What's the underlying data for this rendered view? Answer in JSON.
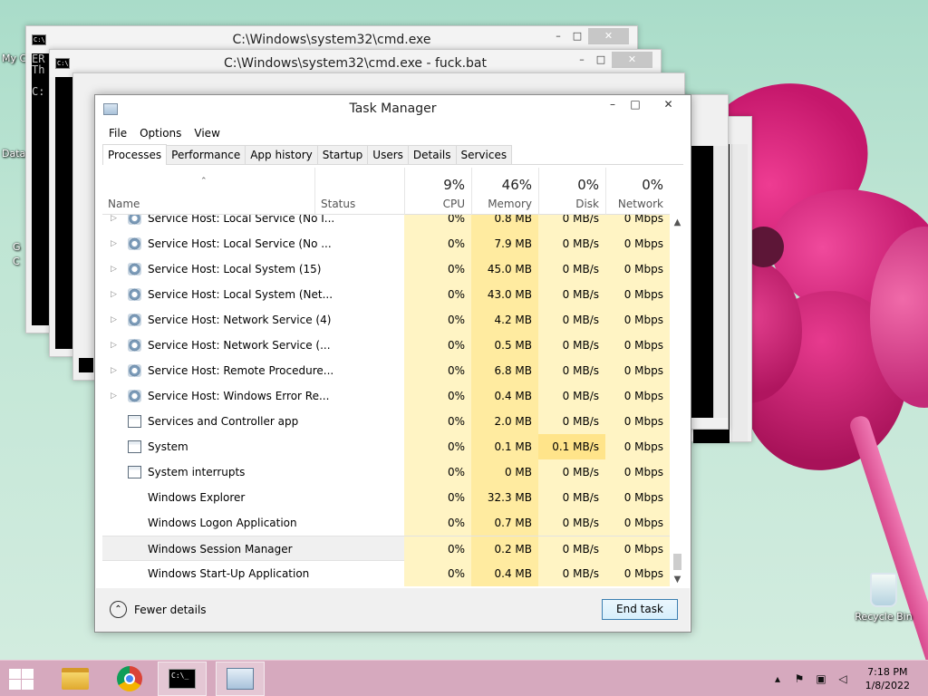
{
  "desktop": {
    "recycle_bin_label": "Recycle Bin",
    "left_icons_partial": [
      "My C",
      "Data",
      "G",
      "C"
    ]
  },
  "cmd_windows": [
    {
      "title": "C:\\Windows\\system32\\cmd.exe",
      "text_lines": [
        "ER",
        "Th",
        "",
        "C:"
      ]
    },
    {
      "title": "C:\\Windows\\system32\\cmd.exe - fuck.bat"
    }
  ],
  "task_manager": {
    "title": "Task Manager",
    "menu": [
      "File",
      "Options",
      "View"
    ],
    "tabs": [
      "Processes",
      "Performance",
      "App history",
      "Startup",
      "Users",
      "Details",
      "Services"
    ],
    "active_tab": "Processes",
    "columns": {
      "name": "Name",
      "status": "Status",
      "cpu": {
        "pct": "9%",
        "label": "CPU"
      },
      "memory": {
        "pct": "46%",
        "label": "Memory"
      },
      "disk": {
        "pct": "0%",
        "label": "Disk"
      },
      "network": {
        "pct": "0%",
        "label": "Network"
      }
    },
    "rows": [
      {
        "name": "Service Host: Local Service (No I...",
        "cpu": "0%",
        "memory": "0.8 MB",
        "disk": "0 MB/s",
        "network": "0 Mbps",
        "icon": "gear-icon",
        "expandable": true
      },
      {
        "name": "Service Host: Local Service (No ...",
        "cpu": "0%",
        "memory": "7.9 MB",
        "disk": "0 MB/s",
        "network": "0 Mbps",
        "icon": "gear-icon",
        "expandable": true
      },
      {
        "name": "Service Host: Local System (15)",
        "cpu": "0%",
        "memory": "45.0 MB",
        "disk": "0 MB/s",
        "network": "0 Mbps",
        "icon": "gear-icon",
        "expandable": true
      },
      {
        "name": "Service Host: Local System (Net...",
        "cpu": "0%",
        "memory": "43.0 MB",
        "disk": "0 MB/s",
        "network": "0 Mbps",
        "icon": "gear-icon",
        "expandable": true
      },
      {
        "name": "Service Host: Network Service (4)",
        "cpu": "0%",
        "memory": "4.2 MB",
        "disk": "0 MB/s",
        "network": "0 Mbps",
        "icon": "gear-icon",
        "expandable": true
      },
      {
        "name": "Service Host: Network Service (...",
        "cpu": "0%",
        "memory": "0.5 MB",
        "disk": "0 MB/s",
        "network": "0 Mbps",
        "icon": "gear-icon",
        "expandable": true
      },
      {
        "name": "Service Host: Remote Procedure...",
        "cpu": "0%",
        "memory": "6.8 MB",
        "disk": "0 MB/s",
        "network": "0 Mbps",
        "icon": "gear-icon",
        "expandable": true
      },
      {
        "name": "Service Host: Windows Error Re...",
        "cpu": "0%",
        "memory": "0.4 MB",
        "disk": "0 MB/s",
        "network": "0 Mbps",
        "icon": "gear-icon",
        "expandable": true
      },
      {
        "name": "Services and Controller app",
        "cpu": "0%",
        "memory": "2.0 MB",
        "disk": "0 MB/s",
        "network": "0 Mbps",
        "icon": "app-icon",
        "expandable": false
      },
      {
        "name": "System",
        "cpu": "0%",
        "memory": "0.1 MB",
        "disk": "0.1 MB/s",
        "network": "0 Mbps",
        "icon": "app-icon",
        "expandable": false
      },
      {
        "name": "System interrupts",
        "cpu": "0%",
        "memory": "0 MB",
        "disk": "0 MB/s",
        "network": "0 Mbps",
        "icon": "app-icon",
        "expandable": false
      },
      {
        "name": "Windows Explorer",
        "cpu": "0%",
        "memory": "32.3 MB",
        "disk": "0 MB/s",
        "network": "0 Mbps",
        "icon": "",
        "expandable": false
      },
      {
        "name": "Windows Logon Application",
        "cpu": "0%",
        "memory": "0.7 MB",
        "disk": "0 MB/s",
        "network": "0 Mbps",
        "icon": "",
        "expandable": false
      },
      {
        "name": "Windows Session Manager",
        "cpu": "0%",
        "memory": "0.2 MB",
        "disk": "0 MB/s",
        "network": "0 Mbps",
        "icon": "",
        "expandable": false,
        "selected": true
      },
      {
        "name": "Windows Start-Up Application",
        "cpu": "0%",
        "memory": "0.4 MB",
        "disk": "0 MB/s",
        "network": "0 Mbps",
        "icon": "",
        "expandable": false
      }
    ],
    "fewer_details": "Fewer details",
    "end_task": "End task"
  },
  "taskbar": {
    "apps": [
      "file-explorer-icon",
      "chrome-icon",
      "cmd-icon",
      "task-manager-icon"
    ],
    "cmd_glyph": "C:\\_",
    "time": "7:18 PM",
    "date": "1/8/2022"
  }
}
